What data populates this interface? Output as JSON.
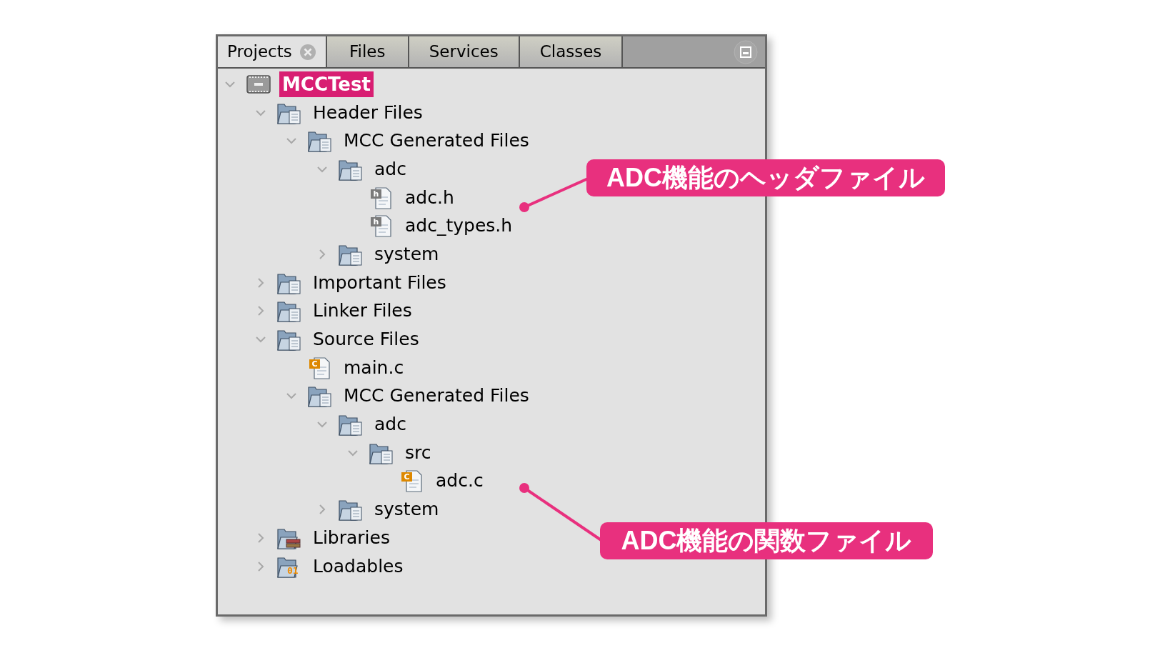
{
  "tabs": [
    {
      "label": "Projects",
      "selected": true,
      "closable": true
    },
    {
      "label": "Files",
      "selected": false,
      "closable": false
    },
    {
      "label": "Services",
      "selected": false,
      "closable": false
    },
    {
      "label": "Classes",
      "selected": false,
      "closable": false
    }
  ],
  "tree": [
    {
      "label": "MCCTest",
      "kind": "project",
      "selected": true,
      "expanded": true,
      "children": [
        {
          "label": "Header Files",
          "kind": "folder",
          "expanded": true,
          "children": [
            {
              "label": "MCC Generated Files",
              "kind": "folder",
              "expanded": true,
              "children": [
                {
                  "label": "adc",
                  "kind": "folder",
                  "expanded": true,
                  "children": [
                    {
                      "label": "adc.h",
                      "kind": "file",
                      "badge": "h"
                    },
                    {
                      "label": "adc_types.h",
                      "kind": "file",
                      "badge": "h"
                    }
                  ]
                },
                {
                  "label": "system",
                  "kind": "folder",
                  "expanded": false
                }
              ]
            }
          ]
        },
        {
          "label": "Important Files",
          "kind": "folder",
          "expanded": false
        },
        {
          "label": "Linker Files",
          "kind": "folder",
          "expanded": false
        },
        {
          "label": "Source Files",
          "kind": "folder",
          "expanded": true,
          "children": [
            {
              "label": "main.c",
              "kind": "file",
              "badge": "C"
            },
            {
              "label": "MCC Generated Files",
              "kind": "folder",
              "expanded": true,
              "children": [
                {
                  "label": "adc",
                  "kind": "folder",
                  "expanded": true,
                  "children": [
                    {
                      "label": "src",
                      "kind": "folder",
                      "expanded": true,
                      "children": [
                        {
                          "label": "adc.c",
                          "kind": "file",
                          "badge": "C"
                        }
                      ]
                    }
                  ]
                },
                {
                  "label": "system",
                  "kind": "folder",
                  "expanded": false
                }
              ]
            }
          ]
        },
        {
          "label": "Libraries",
          "kind": "library",
          "expanded": false
        },
        {
          "label": "Loadables",
          "kind": "loadables",
          "badge": "01",
          "expanded": false
        }
      ]
    }
  ],
  "annotations": [
    {
      "text": "ADC機能のヘッダファイル"
    },
    {
      "text": "ADC機能の関数ファイル"
    }
  ]
}
